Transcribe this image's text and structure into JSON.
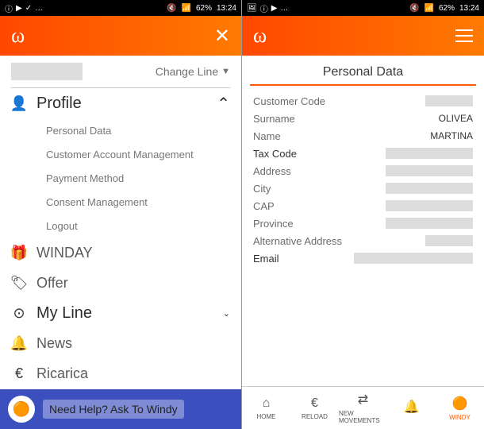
{
  "status": {
    "battery": "62%",
    "time": "13:24"
  },
  "left": {
    "changeLine": "Change Line",
    "menu": {
      "profile": "Profile",
      "sub": {
        "personalData": "Personal Data",
        "cam": "Customer Account Management",
        "payment": "Payment Method",
        "consent": "Consent Management",
        "logout": "Logout"
      },
      "winday": "WINDAY",
      "offer": "Offer",
      "myline": "My Line",
      "news": "News",
      "ricarica": "Ricarica"
    },
    "help": "Need Help? Ask To Windy"
  },
  "right": {
    "title": "Personal Data",
    "fields": {
      "customerCode": "Customer Code",
      "surname": "Surname",
      "surnameVal": "OLIVEA",
      "name": "Name",
      "nameVal": "MARTINA",
      "taxCode": "Tax Code",
      "address": "Address",
      "city": "City",
      "cap": "CAP",
      "province": "Province",
      "altAddress": "Alternative Address",
      "email": "Email"
    },
    "nav": {
      "home": "HOME",
      "reload": "RELOAD",
      "movements": "NEW MOVEMENTS",
      "windy": "WINDY"
    }
  }
}
